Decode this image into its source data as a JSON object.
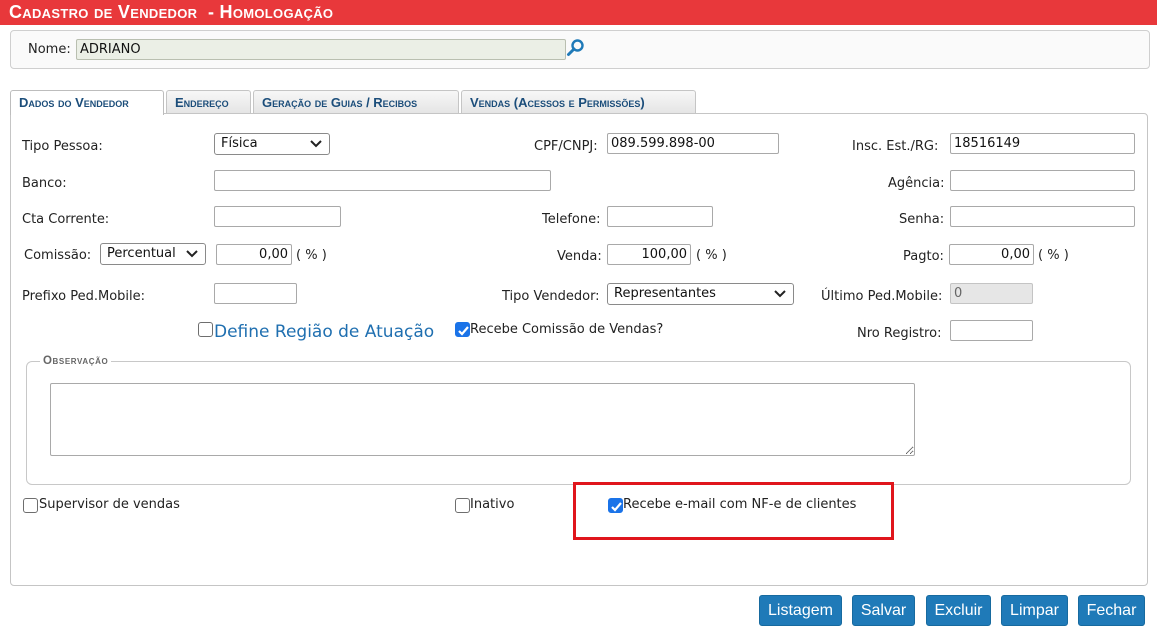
{
  "window": {
    "title": "Cadastro de Vendedor  - Homologação"
  },
  "search": {
    "name_label": "Nome:",
    "name_value": "ADRIANO",
    "icon": "magnifier-icon"
  },
  "tabs": [
    {
      "label": "Dados do Vendedor",
      "active": true
    },
    {
      "label": "Endereço"
    },
    {
      "label": "Geração de Guias / Recibos"
    },
    {
      "label": "Vendas (Acessos e Permissões)"
    }
  ],
  "form": {
    "tipo_pessoa": {
      "label": "Tipo Pessoa:",
      "value": "Física"
    },
    "cpf": {
      "label": "CPF/CNPJ:",
      "value": "089.599.898-00"
    },
    "insc": {
      "label": "Insc. Est./RG:",
      "value": "18516149"
    },
    "banco": {
      "label": "Banco:",
      "value": ""
    },
    "agencia": {
      "label": "Agência:",
      "value": ""
    },
    "cta": {
      "label": "Cta Corrente:",
      "value": ""
    },
    "telefone": {
      "label": "Telefone:",
      "value": ""
    },
    "senha": {
      "label": "Senha:",
      "value": ""
    },
    "comissao": {
      "label": "Comissão:",
      "type": "Percentual",
      "value": "0,00",
      "unit": "( % )"
    },
    "venda": {
      "label": "Venda:",
      "value": "100,00",
      "unit": "( % )"
    },
    "pagto": {
      "label": "Pagto:",
      "value": "0,00",
      "unit": "( % )"
    },
    "prefixo": {
      "label": "Prefixo Ped.Mobile:",
      "value": ""
    },
    "tipo_vendedor": {
      "label": "Tipo Vendedor:",
      "value": "Representantes"
    },
    "ultimo": {
      "label": "Último Ped.Mobile:",
      "value": "0"
    },
    "define_regiao": {
      "label": "Define Região de Atuação",
      "checked": false
    },
    "recebe_comissao": {
      "label": "Recebe Comissão de Vendas?",
      "checked": true
    },
    "nro_registro": {
      "label": "Nro Registro:",
      "value": ""
    },
    "observacao": {
      "legend": "Observação",
      "value": ""
    },
    "supervisor": {
      "label": "Supervisor de vendas",
      "checked": false
    },
    "inativo": {
      "label": "Inativo",
      "checked": false
    },
    "recebe_email": {
      "label": "Recebe e-mail com NF-e de clientes",
      "checked": true
    }
  },
  "buttons": {
    "listagem": "Listagem",
    "salvar": "Salvar",
    "excluir": "Excluir",
    "limpar": "Limpar",
    "fechar": "Fechar"
  },
  "colors": {
    "title_bar": "#e8383b",
    "tab_text": "#1b4d7a",
    "button": "#1f7ab8",
    "highlight": "#e0161c"
  }
}
